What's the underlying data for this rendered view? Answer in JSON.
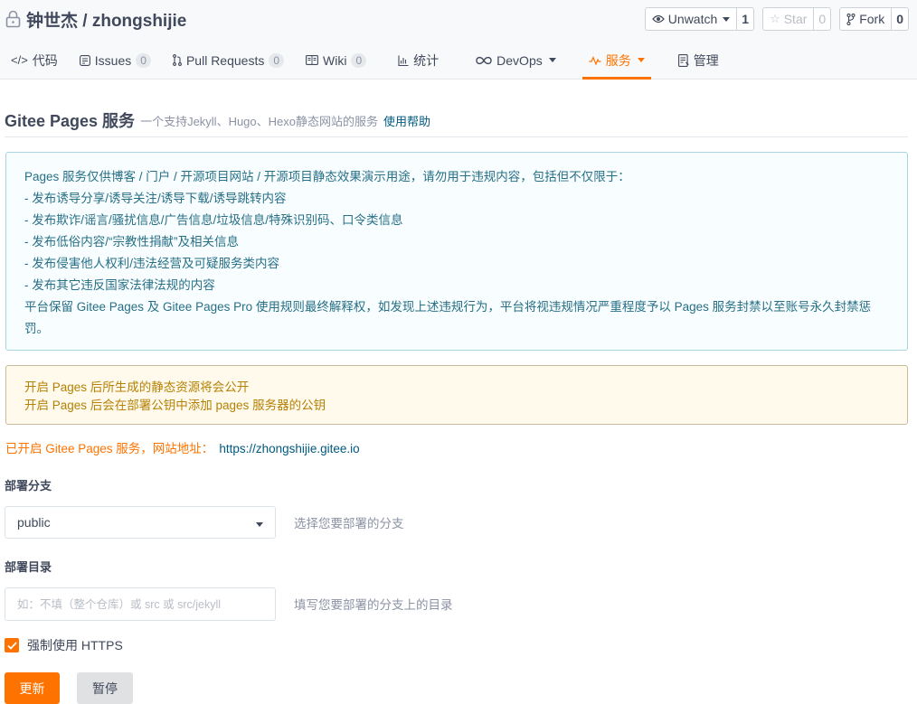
{
  "repo": {
    "title": "钟世杰 / zhongshijie",
    "icon": "lock-icon"
  },
  "actions": [
    {
      "label": "Unwatch",
      "icon": "eye-icon",
      "count": "1",
      "dropdown": true
    },
    {
      "label": "Star",
      "icon": "star-icon",
      "count": "0",
      "disabled": true
    },
    {
      "label": "Fork",
      "icon": "fork-icon",
      "count": "0"
    }
  ],
  "tabs": [
    {
      "label": "代码",
      "icon": "code-icon"
    },
    {
      "label": "Issues",
      "icon": "issues-icon",
      "badge": "0"
    },
    {
      "label": "Pull Requests",
      "icon": "pull-request-icon",
      "badge": "0"
    },
    {
      "label": "Wiki",
      "icon": "wiki-icon",
      "badge": "0"
    },
    {
      "label": "统计",
      "icon": "stats-icon"
    },
    {
      "label": "DevOps",
      "icon": "devops-icon",
      "dropdown": true
    },
    {
      "label": "服务",
      "icon": "pulse-icon",
      "dropdown": true,
      "active": true
    },
    {
      "label": "管理",
      "icon": "manage-icon"
    }
  ],
  "header": {
    "title": "Gitee Pages 服务",
    "subtitle": "一个支持Jekyll、Hugo、Hexo静态网站的服务",
    "help_link": "使用帮助"
  },
  "notice": {
    "lines": [
      "Pages 服务仅供博客 / 门户 / 开源项目网站 / 开源项目静态效果演示用途，请勿用于违规内容，包括但不仅限于：",
      "- 发布诱导分享/诱导关注/诱导下载/诱导跳转内容",
      "- 发布欺诈/谣言/骚扰信息/广告信息/垃圾信息/特殊识别码、口令类信息",
      "- 发布低俗内容/“宗教性捐献”及相关信息",
      "- 发布侵害他人权利/违法经营及可疑服务类内容",
      "- 发布其它违反国家法律法规的内容",
      "平台保留 Gitee Pages 及 Gitee Pages Pro 使用规则最终解释权，如发现上述违规行为，平台将视违规情况严重程度予以 Pages 服务封禁以至账号永久封禁惩罚。"
    ]
  },
  "warning": {
    "lines": [
      "开启 Pages 后所生成的静态资源将会公开",
      "开启 Pages 后会在部署公钥中添加 pages 服务器的公钥"
    ]
  },
  "status": {
    "text": "已开启 Gitee Pages 服务，网站地址：",
    "url": "https://zhongshijie.gitee.io"
  },
  "form": {
    "branch_label": "部署分支",
    "branch_value": "public",
    "branch_hint": "选择您要部署的分支",
    "dir_label": "部署目录",
    "dir_placeholder": "如：不填（整个仓库）或 src 或 src/jekyll",
    "dir_hint": "填写您要部署的分支上的目录",
    "https_label": "强制使用 HTTPS",
    "https_checked": true,
    "update_button": "更新",
    "pause_button": "暂停"
  },
  "colors": {
    "accent": "#fe7300",
    "link": "#005980",
    "notice_text": "#276f86",
    "warning_text": "#b58105"
  }
}
